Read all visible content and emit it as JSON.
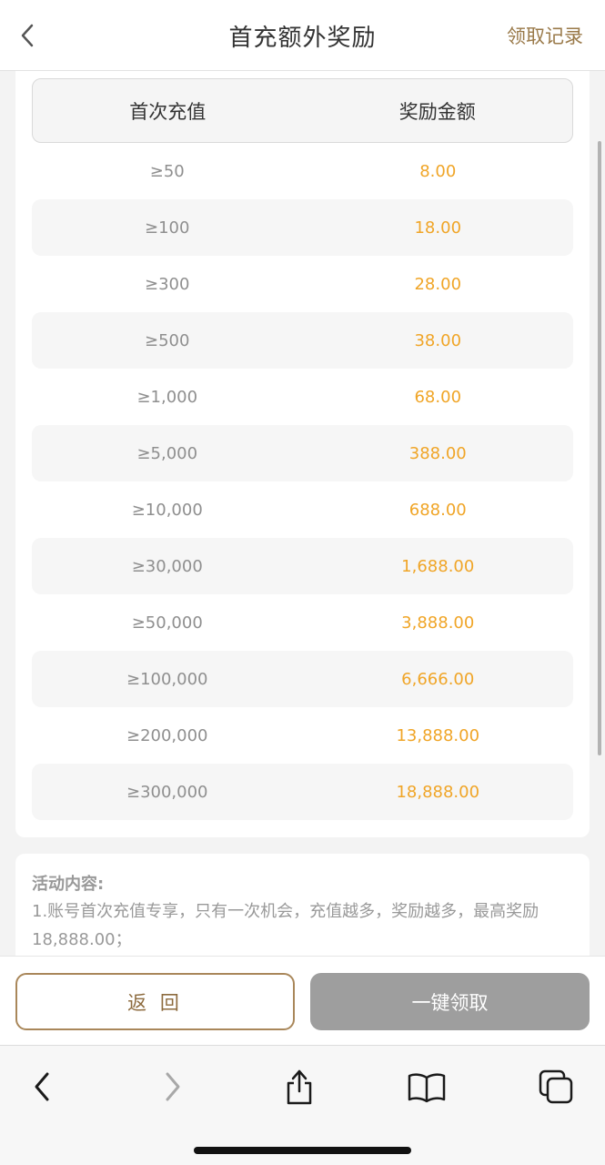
{
  "header": {
    "title": "首充额外奖励",
    "records_label": "领取记录"
  },
  "table": {
    "headers": [
      "首次充值",
      "奖励金额"
    ],
    "rows": [
      {
        "threshold": "≥50",
        "reward": "8.00"
      },
      {
        "threshold": "≥100",
        "reward": "18.00"
      },
      {
        "threshold": "≥300",
        "reward": "28.00"
      },
      {
        "threshold": "≥500",
        "reward": "38.00"
      },
      {
        "threshold": "≥1,000",
        "reward": "68.00"
      },
      {
        "threshold": "≥5,000",
        "reward": "388.00"
      },
      {
        "threshold": "≥10,000",
        "reward": "688.00"
      },
      {
        "threshold": "≥30,000",
        "reward": "1,688.00"
      },
      {
        "threshold": "≥50,000",
        "reward": "3,888.00"
      },
      {
        "threshold": "≥100,000",
        "reward": "6,666.00"
      },
      {
        "threshold": "≥200,000",
        "reward": "13,888.00"
      },
      {
        "threshold": "≥300,000",
        "reward": "18,888.00"
      }
    ]
  },
  "description": {
    "heading": "活动内容:",
    "text": "1.账号首次充值专享，只有一次机会，充值越多，奖励越多，最高奖励18,888.00；"
  },
  "actions": {
    "return_label": "返 回",
    "claim_label": "一键领取"
  },
  "colors": {
    "accent_gold": "#9a7a4a",
    "reward_orange": "#f0a527",
    "disabled_gray": "#9e9e9e"
  },
  "icons": {
    "header_back": "chevron-left-icon",
    "browser_back": "chevron-left-icon",
    "browser_forward": "chevron-right-icon",
    "share": "share-icon",
    "bookmarks": "book-icon",
    "tabs": "tabs-icon"
  }
}
